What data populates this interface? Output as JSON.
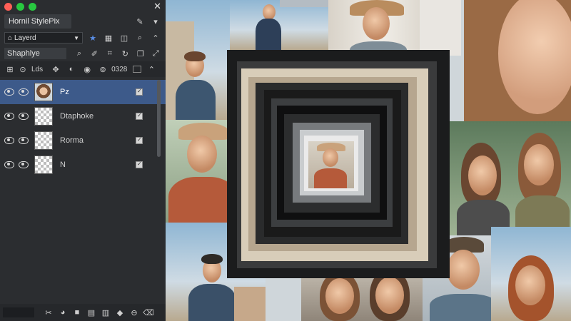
{
  "window": {
    "title": "Hornil StylePix",
    "controls": {
      "close": "✕",
      "colors": [
        "#ff5f57",
        "#28c840",
        "#28c840"
      ]
    }
  },
  "layers_panel": {
    "dropdown_value": "Layerd",
    "search_label": "Shaphlye",
    "tools_text": "Lds",
    "zoom_value": "0328",
    "layers": [
      {
        "name": "Pz",
        "visible": true,
        "selected": true,
        "thumb": "photo"
      },
      {
        "name": "Dtaphoke",
        "visible": true,
        "selected": false,
        "thumb": "transparent"
      },
      {
        "name": "Rorma",
        "visible": true,
        "selected": false,
        "thumb": "transparent"
      },
      {
        "name": "N",
        "visible": true,
        "selected": false,
        "thumb": "transparent"
      }
    ]
  },
  "icons": {
    "title_row": [
      "pin-icon",
      "dropdown-chevron-icon"
    ],
    "toolbar_row": [
      "star-icon",
      "grid-icon",
      "search-icon",
      "view-icon",
      "chevron-up-icon"
    ],
    "search_row": [
      "search-icon",
      "brush-icon",
      "crop-icon",
      "rotate-icon",
      "copy-icon",
      "expand-icon"
    ],
    "tools_row": [
      "select-icon",
      "zoom-icon",
      "move-icon",
      "adjust-icon",
      "paint-icon",
      "clone-icon",
      "stamp-icon"
    ],
    "bottom_row": [
      "scissors-icon",
      "mask-icon",
      "delete-icon",
      "layers-icon",
      "stack-icon",
      "fill-icon",
      "minus-icon",
      "trash-icon"
    ]
  },
  "accent_color": "#3d5a8a"
}
